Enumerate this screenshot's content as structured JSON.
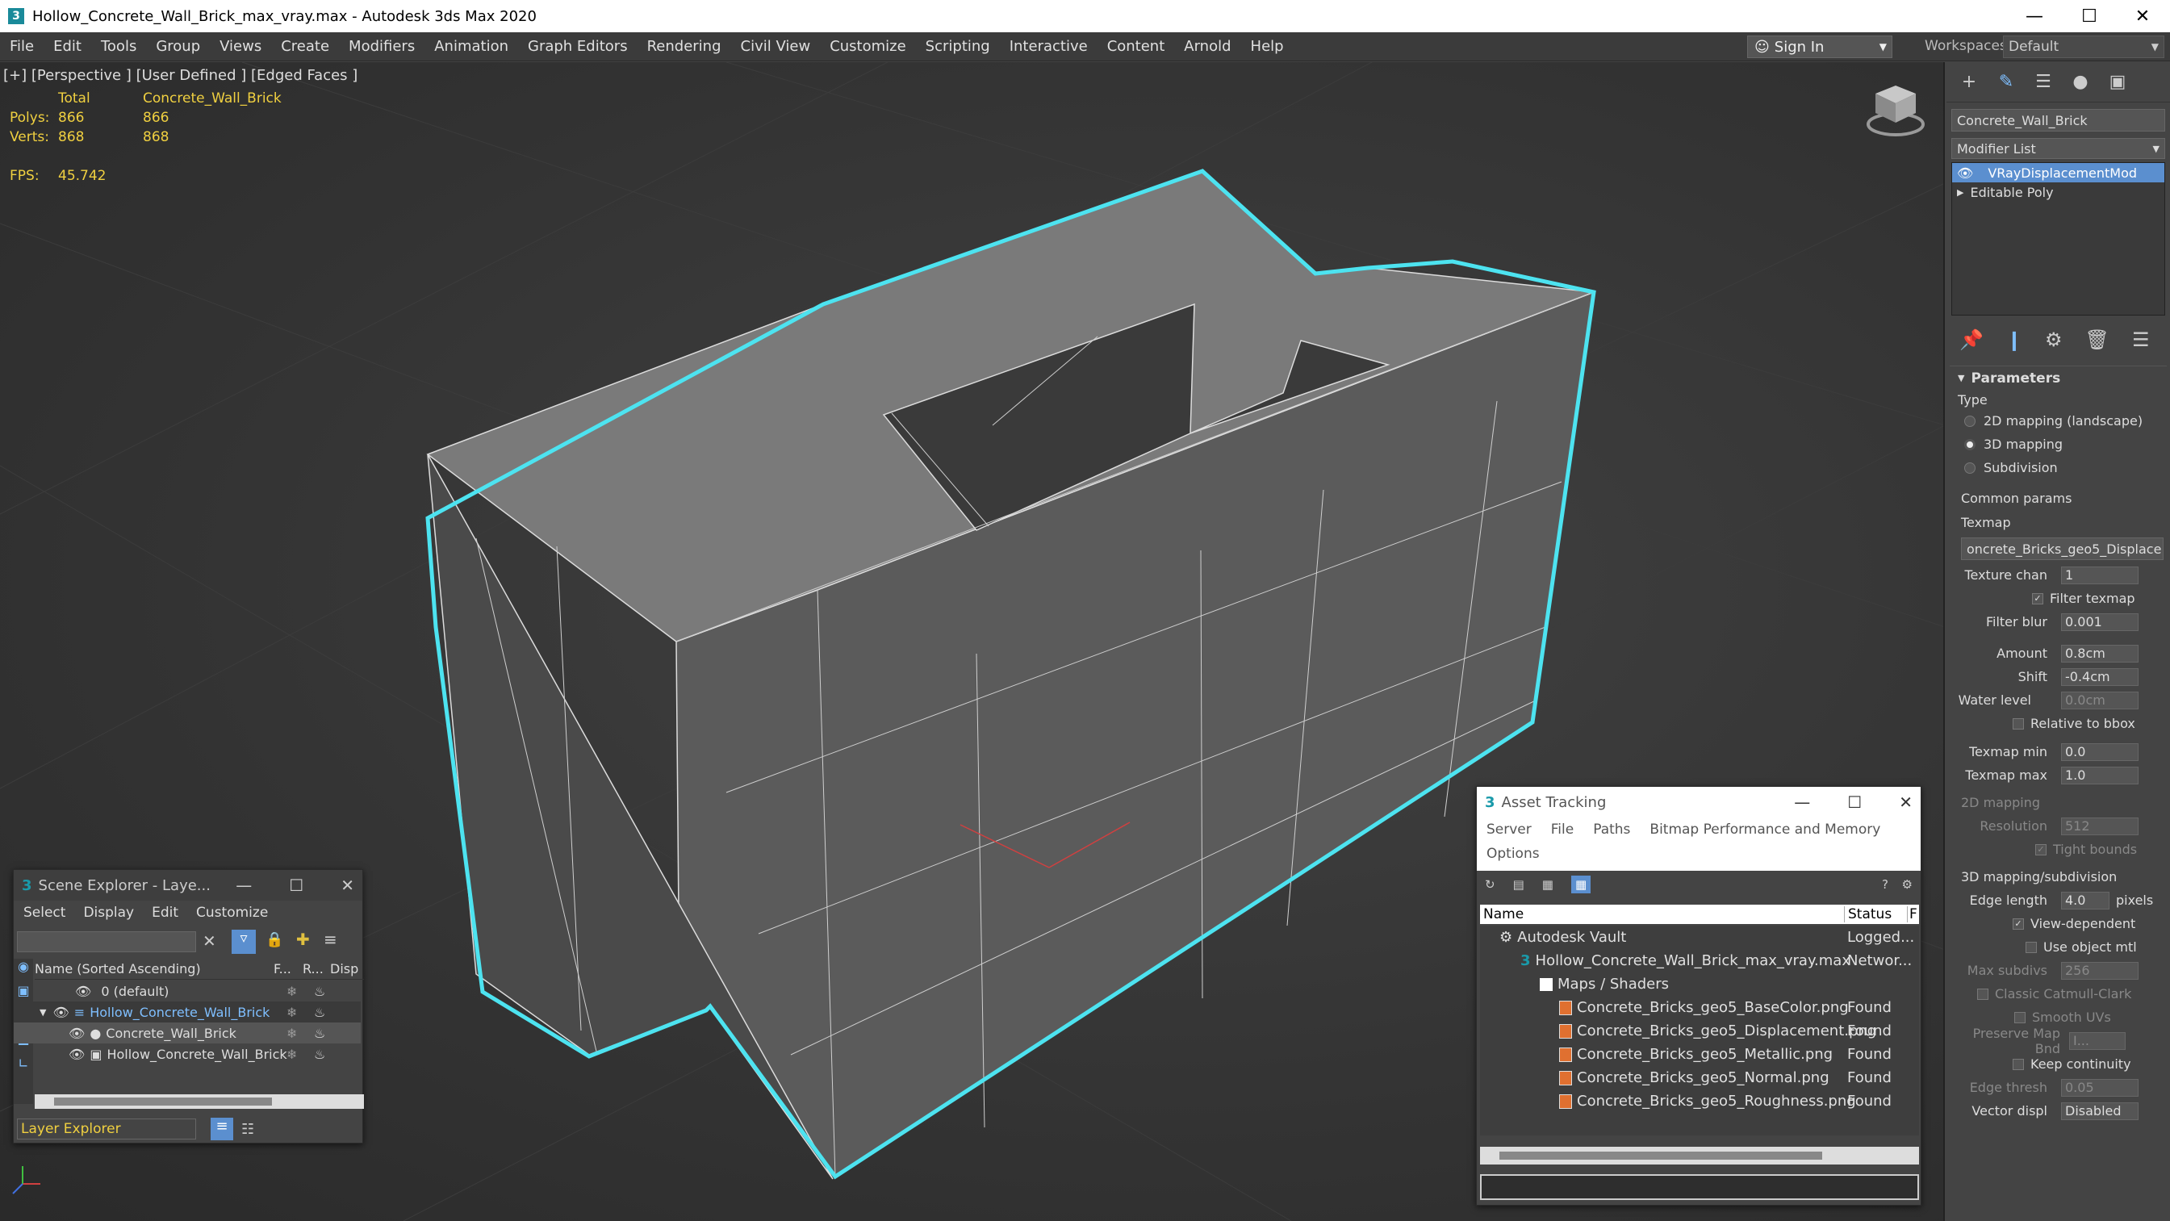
{
  "window": {
    "title": "Hollow_Concrete_Wall_Brick_max_vray.max - Autodesk 3ds Max 2020",
    "minimize": "—",
    "maximize": "☐",
    "close": "✕"
  },
  "menu": [
    "File",
    "Edit",
    "Tools",
    "Group",
    "Views",
    "Create",
    "Modifiers",
    "Animation",
    "Graph Editors",
    "Rendering",
    "Civil View",
    "Customize",
    "Scripting",
    "Interactive",
    "Content",
    "Arnold",
    "Help"
  ],
  "signin": {
    "label": "Sign In"
  },
  "workspaces": {
    "label": "Workspaces:",
    "value": "Default"
  },
  "viewport": {
    "label": "[+] [Perspective ] [User Defined ] [Edged Faces ]",
    "stats": {
      "total_label": "Total",
      "object_label": "Concrete_Wall_Brick",
      "polys_label": "Polys:",
      "polys_total": "866",
      "polys_obj": "866",
      "verts_label": "Verts:",
      "verts_total": "868",
      "verts_obj": "868",
      "fps_label": "FPS:",
      "fps_value": "45.742"
    },
    "colors": {
      "selection": "#4de3f0",
      "brick": "#6a6a6a"
    }
  },
  "command_panel": {
    "object_name": "Concrete_Wall_Brick",
    "modifier_list": "Modifier List",
    "stack": [
      "VRayDisplacementMod",
      "Editable Poly"
    ],
    "parameters_title": "Parameters",
    "type_label": "Type",
    "type_options": [
      "2D mapping (landscape)",
      "3D mapping",
      "Subdivision"
    ],
    "common_params": "Common params",
    "texmap_label": "Texmap",
    "texmap_value": "oncrete_Bricks_geo5_Displace",
    "texture_chan": {
      "label": "Texture chan",
      "value": "1"
    },
    "filter_texmap": "Filter texmap",
    "filter_blur": {
      "label": "Filter blur",
      "value": "0.001"
    },
    "amount": {
      "label": "Amount",
      "value": "0.8cm"
    },
    "shift": {
      "label": "Shift",
      "value": "-0.4cm"
    },
    "water_level": {
      "label": "Water level",
      "value": "0.0cm"
    },
    "relative_bbox": "Relative to bbox",
    "texmap_min": {
      "label": "Texmap min",
      "value": "0.0"
    },
    "texmap_max": {
      "label": "Texmap max",
      "value": "1.0"
    },
    "mapping2d": "2D mapping",
    "resolution": {
      "label": "Resolution",
      "value": "512"
    },
    "tight_bounds": "Tight bounds",
    "mapping3d": "3D mapping/subdivision",
    "edge_length": {
      "label": "Edge length",
      "value": "4.0",
      "unit": "pixels"
    },
    "view_dependent": "View-dependent",
    "use_object_mtl": "Use object mtl",
    "max_subdivs": {
      "label": "Max subdivs",
      "value": "256"
    },
    "classic_cc": "Classic Catmull-Clark",
    "smooth_uvs": "Smooth UVs",
    "preserve_map": {
      "label": "Preserve Map Bnd",
      "value": "I..."
    },
    "keep_continuity": "Keep continuity",
    "edge_thresh": {
      "label": "Edge thresh",
      "value": "0.05"
    },
    "vector_displ": {
      "label": "Vector displ",
      "value": "Disabled"
    }
  },
  "scene_explorer": {
    "title": "Scene Explorer - Laye...",
    "menu": [
      "Select",
      "Display",
      "Edit",
      "Customize"
    ],
    "col_name": "Name (Sorted Ascending)",
    "col_f": "F...",
    "col_r": "R...",
    "col_d": "Disp",
    "rows": [
      "0 (default)",
      "Hollow_Concrete_Wall_Brick",
      "Concrete_Wall_Brick",
      "Hollow_Concrete_Wall_Brick"
    ],
    "footer": "Layer Explorer"
  },
  "asset_tracking": {
    "title": "Asset Tracking",
    "menu": [
      "Server",
      "File",
      "Paths",
      "Bitmap Performance and Memory"
    ],
    "menu2": "Options",
    "col_name": "Name",
    "col_status": "Status",
    "col_extra": "F",
    "rows": [
      {
        "name": "Autodesk Vault",
        "status": "Logged..."
      },
      {
        "name": "Hollow_Concrete_Wall_Brick_max_vray.max",
        "status": "Networ..."
      },
      {
        "name": "Maps / Shaders",
        "status": ""
      },
      {
        "name": "Concrete_Bricks_geo5_BaseColor.png",
        "status": "Found"
      },
      {
        "name": "Concrete_Bricks_geo5_Displacement.png",
        "status": "Found"
      },
      {
        "name": "Concrete_Bricks_geo5_Metallic.png",
        "status": "Found"
      },
      {
        "name": "Concrete_Bricks_geo5_Normal.png",
        "status": "Found"
      },
      {
        "name": "Concrete_Bricks_geo5_Roughness.png",
        "status": "Found"
      }
    ]
  }
}
